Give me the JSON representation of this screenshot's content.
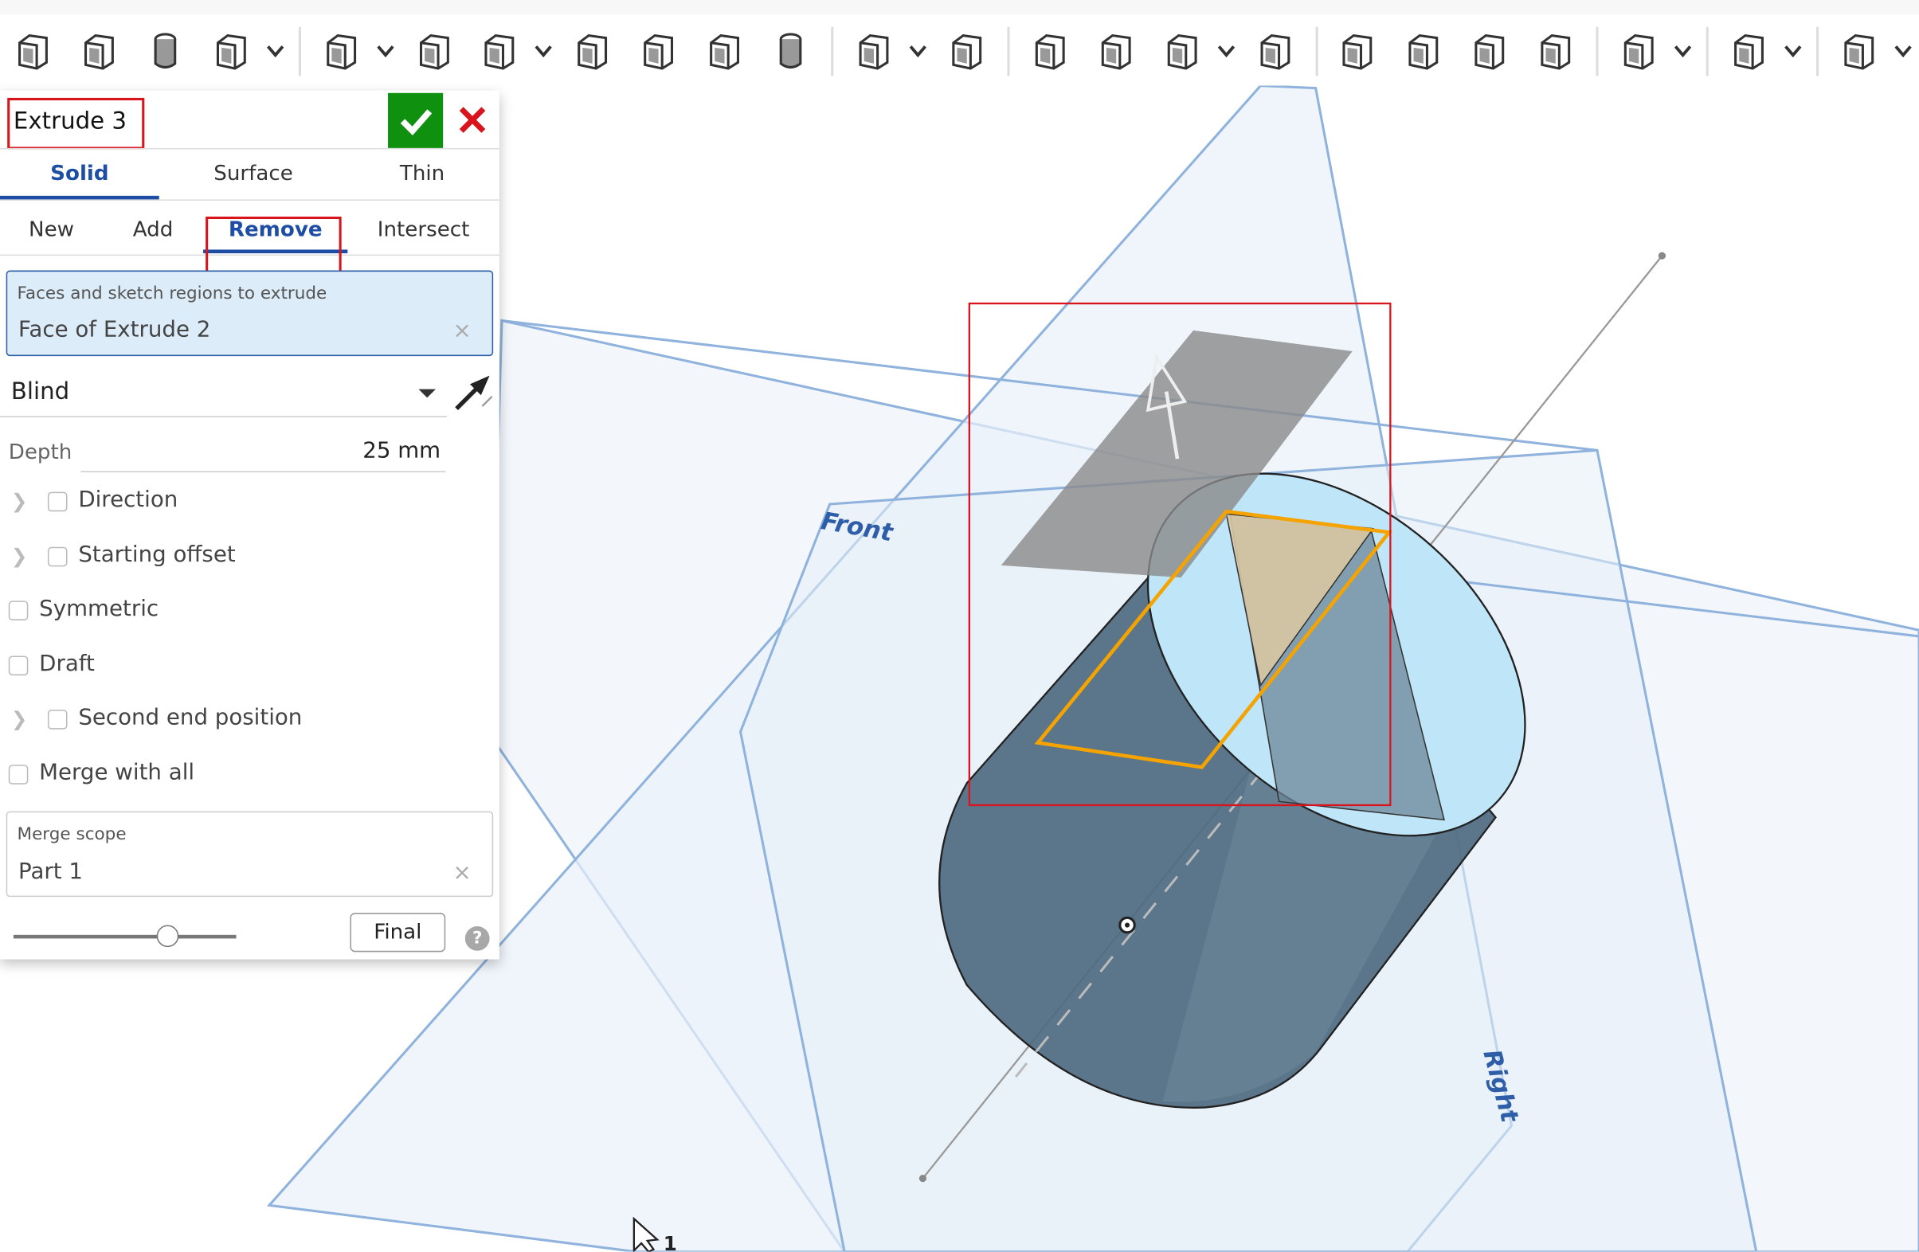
{
  "toolbar": {
    "items": [
      "revolve-icon",
      "sweep-icon",
      "loft-icon",
      "thicken-icon",
      "chevron",
      "sep",
      "fillet-icon",
      "chevron",
      "chamfer-icon",
      "draft-icon",
      "chevron",
      "rib-icon",
      "shell-icon",
      "hole-icon",
      "thread-icon",
      "sep",
      "pattern-icon",
      "chevron",
      "mirror-icon",
      "sep",
      "boolean-icon",
      "split-icon",
      "transform-icon",
      "chevron",
      "delete-part-icon",
      "sep",
      "modify-fillet-icon",
      "delete-face-icon",
      "move-face-icon",
      "replace-face-icon",
      "sep",
      "plane-icon",
      "chevron",
      "sep",
      "sheet-metal-icon",
      "chevron",
      "sep",
      "frame-icon",
      "chevron"
    ]
  },
  "panel": {
    "title": "Extrude 3",
    "confirm": "check-icon",
    "cancel": "close-icon",
    "body_tabs": [
      {
        "label": "Solid",
        "active": true
      },
      {
        "label": "Surface",
        "active": false
      },
      {
        "label": "Thin",
        "active": false
      }
    ],
    "operation_tabs": [
      {
        "label": "New",
        "active": false
      },
      {
        "label": "Add",
        "active": false
      },
      {
        "label": "Remove",
        "active": true
      },
      {
        "label": "Intersect",
        "active": false
      }
    ],
    "faces_field": {
      "label": "Faces and sketch regions to extrude",
      "value": "Face of Extrude 2"
    },
    "end_type": {
      "value": "Blind"
    },
    "depth": {
      "label": "Depth",
      "value": "25 mm"
    },
    "options": [
      {
        "label": "Direction",
        "checked": false,
        "expandable": true
      },
      {
        "label": "Starting offset",
        "checked": false,
        "expandable": true
      },
      {
        "label": "Symmetric",
        "checked": false,
        "expandable": false
      },
      {
        "label": "Draft",
        "checked": false,
        "expandable": false
      },
      {
        "label": "Second end position",
        "checked": false,
        "expandable": true
      },
      {
        "label": "Merge with all",
        "checked": false,
        "expandable": false
      }
    ],
    "merge_scope": {
      "label": "Merge scope",
      "value": "Part 1"
    },
    "rollback_slider": {
      "value": 0.69
    },
    "final_button": "Final",
    "help": "?"
  },
  "viewport": {
    "plane_labels": {
      "front": "Front",
      "right": "Right"
    },
    "cursor_badge": "1"
  },
  "colors": {
    "accent": "#1d4ea4",
    "confirm": "#10900f",
    "cancel": "#d9141c",
    "highlight_box": "#d9141c",
    "selection_edge": "#f5a300",
    "plane_edge": "#8fb3dc",
    "part_body": "#4e6a80",
    "selected_face": "#bfe6f8"
  }
}
